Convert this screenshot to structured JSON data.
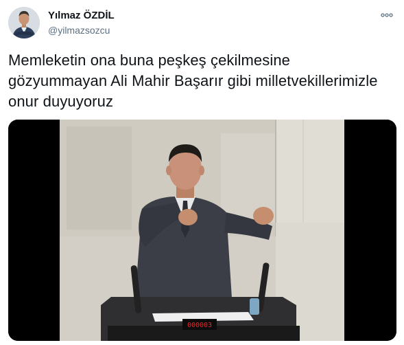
{
  "author": {
    "display_name": "Yılmaz ÖZDİL",
    "handle": "@yilmazsozcu",
    "avatar_icon": "profile-photo-avatar"
  },
  "more_icon": "more-horizontal-icon",
  "tweet": {
    "text_lines": [
      "Memleketin ona buna peşkeş çekilmesine",
      "gözyummayan Ali Mahir Başarır gibi milletvekillerimizle",
      "onur duyuyoruz"
    ]
  },
  "media": {
    "kind": "video-still",
    "counter_display": "000003",
    "counter_color": "#e8262b"
  },
  "colors": {
    "text": "#0f1419",
    "secondary": "#5b7083"
  }
}
